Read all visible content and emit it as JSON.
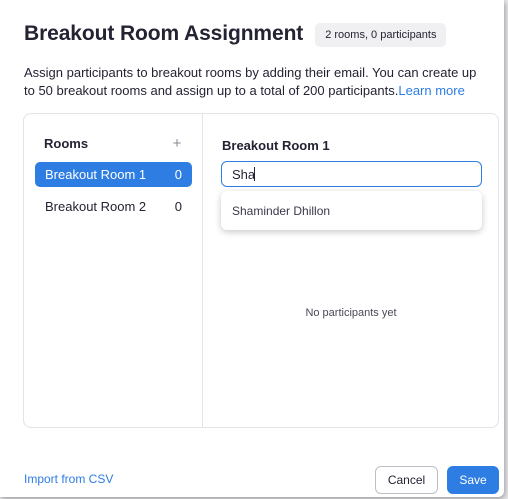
{
  "dialog": {
    "title": "Breakout Room Assignment",
    "badge": "2 rooms, 0 participants",
    "description": "Assign participants to breakout rooms by adding their email. You can create up to 50 breakout rooms and assign up to a total of 200 participants.",
    "learn_more": "Learn more"
  },
  "rooms": {
    "header": "Rooms",
    "add_icon": "+",
    "items": [
      {
        "label": "Breakout Room 1",
        "count": "0",
        "selected": true
      },
      {
        "label": "Breakout Room 2",
        "count": "0",
        "selected": false
      }
    ]
  },
  "detail": {
    "title": "Breakout Room 1",
    "search_value": "Sha",
    "suggestion": "Shaminder Dhillon",
    "empty_text": "No participants yet"
  },
  "footer": {
    "import_label": "Import from CSV",
    "cancel_label": "Cancel",
    "save_label": "Save"
  },
  "colors": {
    "accent": "#2d7de3",
    "text": "#232333",
    "border": "#e3e3e8"
  },
  "icons": {
    "add_room": "plus-icon"
  }
}
